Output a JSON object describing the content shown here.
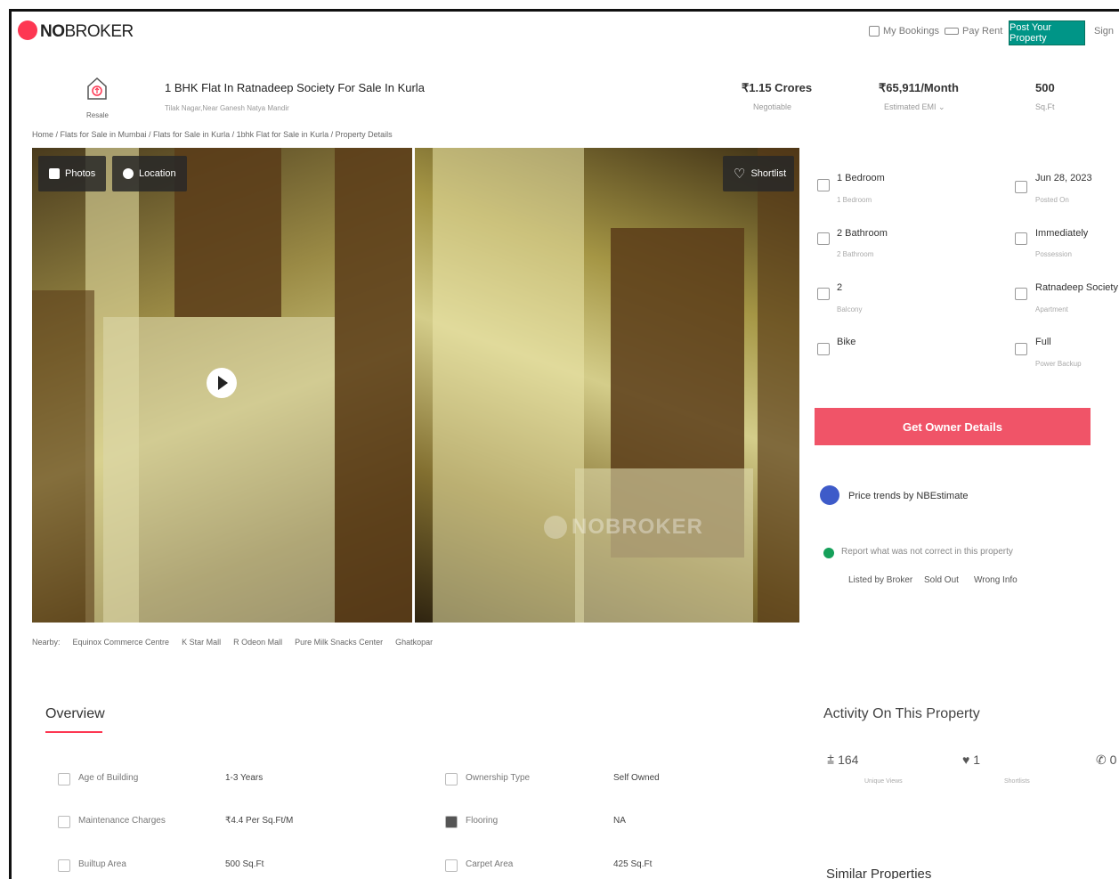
{
  "header": {
    "logo_text_bold": "NO",
    "logo_text_rest": "BROKER",
    "my_bookings": "My Bookings",
    "pay_rent": "Pay Rent",
    "post_property": "Post Your Property",
    "sign_up": "Sign"
  },
  "listing": {
    "type_label": "Resale",
    "title": "1 BHK Flat In Ratnadeep Society For Sale In Kurla",
    "subtitle": "Tilak Nagar,Near Ganesh Natya Mandir",
    "price": "₹1.15 Crores",
    "price_note": "Negotiable",
    "emi": "₹65,911/Month",
    "emi_note": "Estimated EMI ⌄",
    "area": "500",
    "area_unit": "Sq.Ft"
  },
  "breadcrumb": "Home / Flats for Sale in Mumbai / Flats for Sale in Kurla / 1bhk Flat for Sale in Kurla / Property Details",
  "gallery": {
    "photos_label": "Photos",
    "location_label": "Location",
    "shortlist_label": "Shortlist",
    "watermark": "NOBROKER"
  },
  "nearby": {
    "label": "Nearby:",
    "items": [
      "Equinox Commerce Centre",
      "K Star Mall",
      "R Odeon Mall",
      "Pure Milk Snacks Center",
      "Ghatkopar"
    ]
  },
  "features": [
    {
      "value": "1 Bedroom",
      "label": "1 Bedroom"
    },
    {
      "value": "Jun 28, 2023",
      "label": "Posted On"
    },
    {
      "value": "2 Bathroom",
      "label": "2 Bathroom"
    },
    {
      "value": "Immediately",
      "label": "Possession"
    },
    {
      "value": "2",
      "label": "Balcony"
    },
    {
      "value": "Ratnadeep Society",
      "label": "Apartment"
    },
    {
      "value": "Bike",
      "label": ""
    },
    {
      "value": "Full",
      "label": "Power Backup"
    }
  ],
  "actions": {
    "get_owner_details": "Get Owner Details",
    "price_trends": "Price trends by NBEstimate",
    "report_text": "Report what was not correct in this property",
    "report_options": [
      "Listed by Broker",
      "Sold Out",
      "Wrong Info"
    ]
  },
  "overview": {
    "title": "Overview",
    "rows": [
      {
        "label": "Age of Building",
        "value": "1-3 Years"
      },
      {
        "label": "Ownership Type",
        "value": "Self Owned"
      },
      {
        "label": "Maintenance Charges",
        "value": "₹4.4 Per Sq.Ft/M"
      },
      {
        "label": "Flooring",
        "value": "NA"
      },
      {
        "label": "Builtup Area",
        "value": "500 Sq.Ft"
      },
      {
        "label": "Carpet Area",
        "value": "425 Sq.Ft"
      }
    ]
  },
  "activity": {
    "title": "Activity On This Property",
    "unique_views": "164",
    "unique_views_label": "Unique Views",
    "shortlists": "1",
    "shortlists_label": "Shortlists",
    "contacts": "0"
  },
  "similar_title": "Similar Properties"
}
